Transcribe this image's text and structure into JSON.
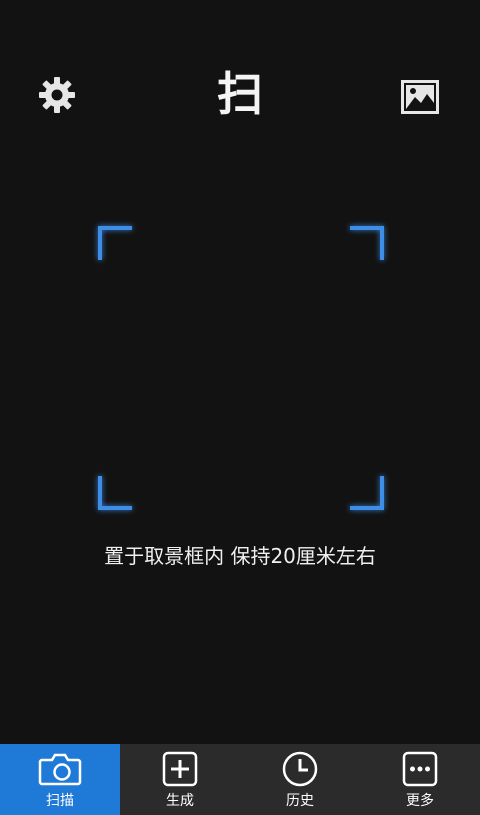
{
  "header": {
    "title": "扫",
    "settings_icon": "gear-icon",
    "gallery_icon": "image-icon"
  },
  "scanner": {
    "hint": "置于取景框内 保持20厘米左右",
    "frame_color": "#3e8ee8"
  },
  "bottom_nav": {
    "active_color": "#1f79d6",
    "items": [
      {
        "label": "扫描",
        "icon": "camera-icon",
        "active": true
      },
      {
        "label": "生成",
        "icon": "plus-square-icon",
        "active": false
      },
      {
        "label": "历史",
        "icon": "clock-icon",
        "active": false
      },
      {
        "label": "更多",
        "icon": "more-dots-icon",
        "active": false
      }
    ]
  }
}
